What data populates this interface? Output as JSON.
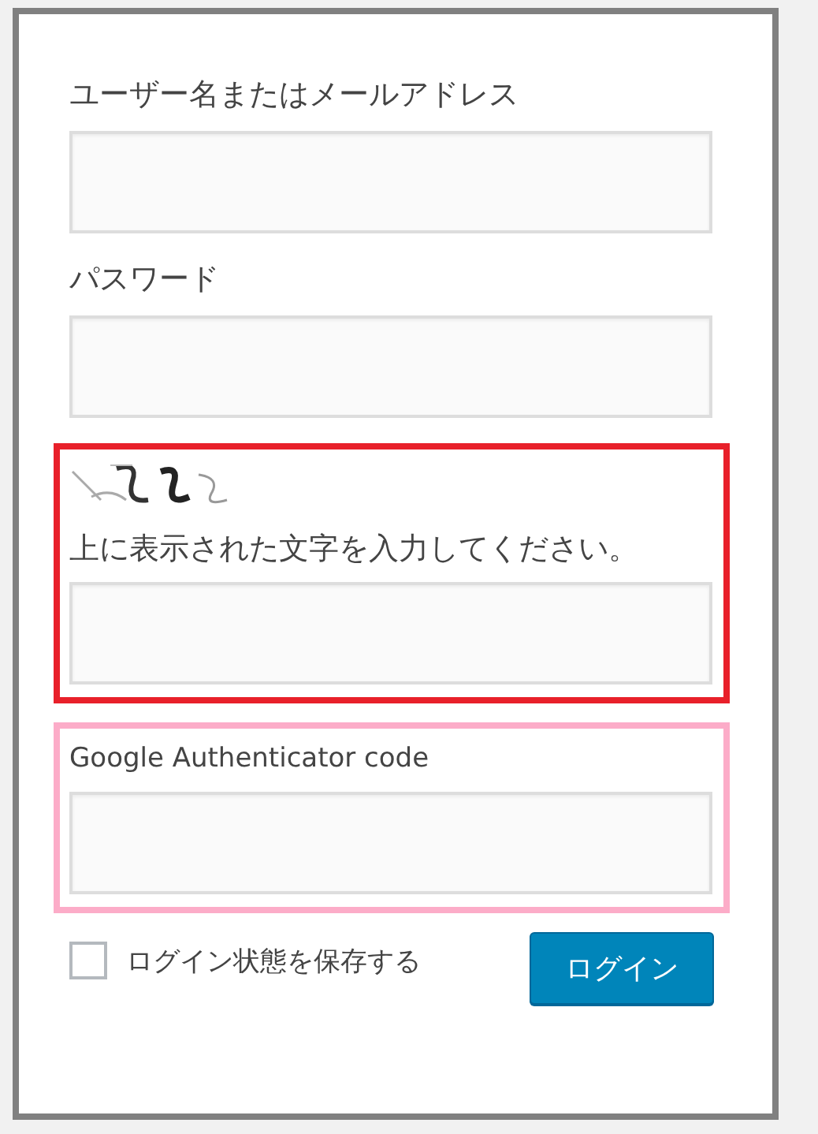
{
  "sections": [
    {
      "kind": "text-field",
      "label": "ユーザー名またはメールアドレス"
    },
    {
      "kind": "text-field",
      "label": "パスワード"
    },
    {
      "kind": "captcha",
      "label": "上に表示された文字を入力してください。",
      "color": "#e8202a"
    },
    {
      "kind": "code-field",
      "label": "Google Authenticator code",
      "color": "#fcacc8"
    }
  ],
  "remember": {
    "label": "ログイン状態を保存する",
    "checked": false
  },
  "submit": {
    "label": "ログイン"
  }
}
